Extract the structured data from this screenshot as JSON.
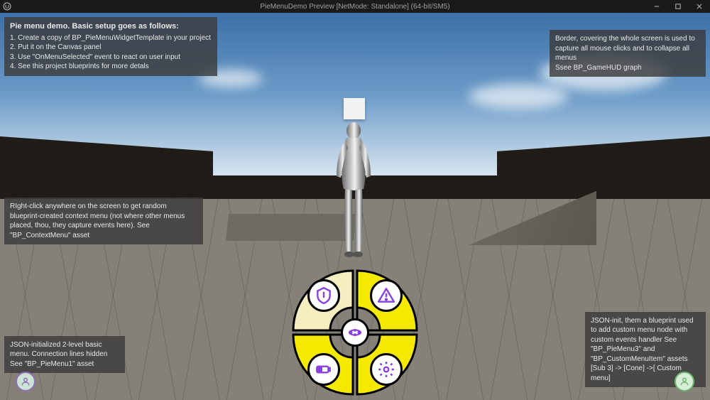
{
  "window": {
    "title": "PieMenuDemo Preview [NetMode: Standalone]  (64-bit/SM5)"
  },
  "hud": {
    "topLeft": {
      "title": "Pie menu demo. Basic setup goes as follows:",
      "line1": "1. Create a copy of BP_PieMenuWidgetTemplate in your project",
      "line2": "2. Put it on the Canvas panel",
      "line3": "3. Use \"OnMenuSelected\" event to react on user input",
      "line4": "4. See this project blueprints for more detals"
    },
    "topRight": {
      "line1": "Border, covering the whole screen is used to capture all mouse clicks and to collapse all menus",
      "line2": "Ssee BP_GameHUD graph"
    },
    "midLeft": "RIght-click anywhere on the screen to get random blueprint-created context menu (not  where other menus placed, thou, they capture events here). See \"BP_ContextMenu\" asset",
    "botLeft": "JSON-initialized 2-level basic menu. Connection lines hidden See \"BP_PieMenu1\" asset",
    "botRight": "JSON-init, them a blueprint used to add custom menu node with custom events handler See \"BP_PieMenu3\" and \"BP_CustomMenuItem\" assets [Sub 3] -> [Cone]  ->[ Custom menu]"
  },
  "pieMenu": {
    "slices": [
      {
        "id": "tl",
        "iconName": "shield-icon",
        "fill": "#f3edc0"
      },
      {
        "id": "tr",
        "iconName": "warning-icon",
        "fill": "#f5e900"
      },
      {
        "id": "bl",
        "iconName": "battery-icon",
        "fill": "#f5e900"
      },
      {
        "id": "br",
        "iconName": "gear-icon",
        "fill": "#f5e900"
      }
    ],
    "centerIconName": "mesh-icon"
  },
  "avatars": {
    "left": "user-icon",
    "right": "user-icon"
  },
  "colors": {
    "iconStroke": "#8a3fe0",
    "sliceStroke": "#000000"
  }
}
